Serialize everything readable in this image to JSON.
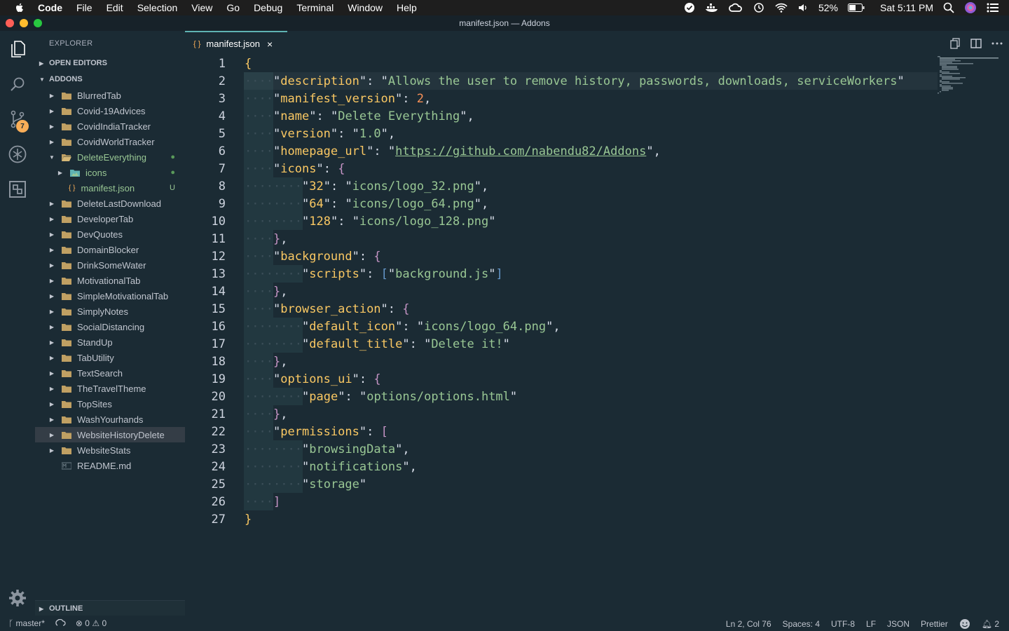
{
  "menubar": {
    "app": "Code",
    "items": [
      "File",
      "Edit",
      "Selection",
      "View",
      "Go",
      "Debug",
      "Terminal",
      "Window",
      "Help"
    ],
    "battery": "52%",
    "clock": "Sat 5:11 PM"
  },
  "window": {
    "title": "manifest.json — Addons"
  },
  "activity": {
    "scm_badge": "7"
  },
  "sidebar": {
    "header": "EXPLORER",
    "open_editors": "OPEN EDITORS",
    "folder": "ADDONS",
    "outline": "OUTLINE",
    "tree": [
      {
        "label": "BlurredTab",
        "type": "folder"
      },
      {
        "label": "Covid-19Advices",
        "type": "folder"
      },
      {
        "label": "CovidIndiaTracker",
        "type": "folder"
      },
      {
        "label": "CovidWorldTracker",
        "type": "folder"
      },
      {
        "label": "DeleteEverything",
        "type": "folder-open",
        "mark": "●"
      },
      {
        "label": "icons",
        "type": "subfolder",
        "mark": "●"
      },
      {
        "label": "manifest.json",
        "type": "file",
        "mark": "U"
      },
      {
        "label": "DeleteLastDownload",
        "type": "folder"
      },
      {
        "label": "DeveloperTab",
        "type": "folder"
      },
      {
        "label": "DevQuotes",
        "type": "folder"
      },
      {
        "label": "DomainBlocker",
        "type": "folder"
      },
      {
        "label": "DrinkSomeWater",
        "type": "folder"
      },
      {
        "label": "MotivationalTab",
        "type": "folder"
      },
      {
        "label": "SimpleMotivationalTab",
        "type": "folder"
      },
      {
        "label": "SimplyNotes",
        "type": "folder"
      },
      {
        "label": "SocialDistancing",
        "type": "folder"
      },
      {
        "label": "StandUp",
        "type": "folder"
      },
      {
        "label": "TabUtility",
        "type": "folder"
      },
      {
        "label": "TextSearch",
        "type": "folder"
      },
      {
        "label": "TheTravelTheme",
        "type": "folder"
      },
      {
        "label": "TopSites",
        "type": "folder"
      },
      {
        "label": "WashYourhands",
        "type": "folder"
      },
      {
        "label": "WebsiteHistoryDelete",
        "type": "folder",
        "selected": true
      },
      {
        "label": "WebsiteStats",
        "type": "folder"
      },
      {
        "label": "README.md",
        "type": "readme"
      }
    ]
  },
  "tab": {
    "label": "manifest.json",
    "icon": "{ }"
  },
  "code": {
    "line_numbers": [
      "1",
      "2",
      "3",
      "4",
      "5",
      "6",
      "7",
      "8",
      "9",
      "10",
      "11",
      "12",
      "13",
      "14",
      "15",
      "16",
      "17",
      "18",
      "19",
      "20",
      "21",
      "22",
      "23",
      "24",
      "25",
      "26",
      "27"
    ],
    "lines": [
      "{",
      "    \"description\": \"Allows the user to remove history, passwords, downloads, serviceWorkers\"",
      "    \"manifest_version\": 2,",
      "    \"name\": \"Delete Everything\",",
      "    \"version\": \"1.0\",",
      "    \"homepage_url\": \"https://github.com/nabendu82/Addons\",",
      "    \"icons\": {",
      "        \"32\": \"icons/logo_32.png\",",
      "        \"64\": \"icons/logo_64.png\",",
      "        \"128\": \"icons/logo_128.png\"",
      "    },",
      "    \"background\": {",
      "        \"scripts\": [\"background.js\"]",
      "    },",
      "    \"browser_action\": {",
      "        \"default_icon\": \"icons/logo_64.png\",",
      "        \"default_title\": \"Delete it!\"",
      "    },",
      "    \"options_ui\": {",
      "        \"page\": \"options/options.html\"",
      "    },",
      "    \"permissions\": [",
      "        \"browsingData\",",
      "        \"notifications\",",
      "        \"storage\"",
      "    ]",
      "}"
    ]
  },
  "status": {
    "branch": "master*",
    "errors": "0",
    "warnings": "0",
    "cursor": "Ln 2, Col 76",
    "spaces": "Spaces: 4",
    "encoding": "UTF-8",
    "eol": "LF",
    "language": "JSON",
    "formatter": "Prettier",
    "notifications": "2"
  },
  "colors": {
    "background": "#1b2b34",
    "key": "#fac863",
    "string": "#99c794",
    "number": "#f99157",
    "accent": "#5fb3b3",
    "folder": "#f9ae58"
  }
}
